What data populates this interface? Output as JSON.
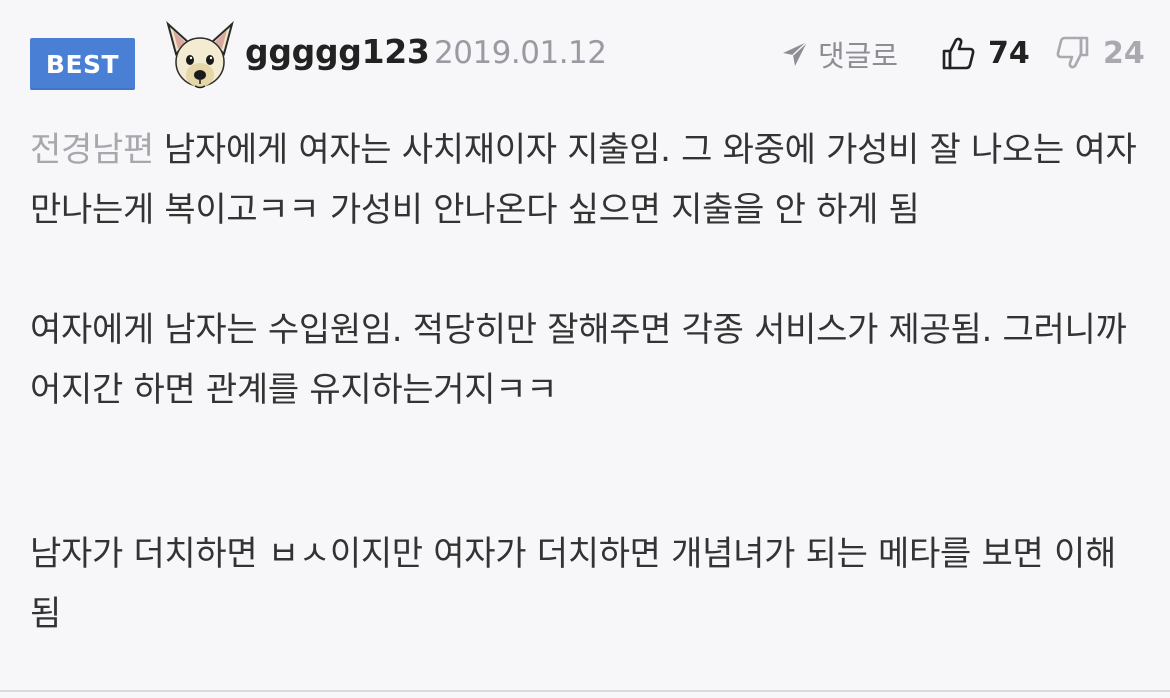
{
  "comment": {
    "badge": "BEST",
    "username": "ggggg123",
    "date": "2019.01.12",
    "reply_label": "댓글로",
    "likes": "74",
    "dislikes": "24",
    "reply_to": "전경남편",
    "paragraphs": [
      "남자에게 여자는 사치재이자 지출임. 그 와중에 가성비 잘 나오는 여자 만나는게 복이고ㅋㅋ 가성비 안나온다 싶으면 지출을 안 하게 됨",
      "여자에게 남자는 수입원임. 적당히만 잘해주면 각종 서비스가 제공됨. 그러니까 어지간 하면 관계를 유지하는거지ㅋㅋ",
      "남자가 더치하면 ㅂㅅ이지만 여자가 더치하면 개념녀가 되는 메타를 보면 이해됨"
    ]
  },
  "icons": {
    "reply": "send-arrow-icon",
    "like": "thumbs-up-icon",
    "dislike": "thumbs-down-icon",
    "avatar": "dog-avatar"
  },
  "colors": {
    "badge": "#4a7fd6",
    "background": "#f7f7f9",
    "muted": "#9a9aa2"
  }
}
